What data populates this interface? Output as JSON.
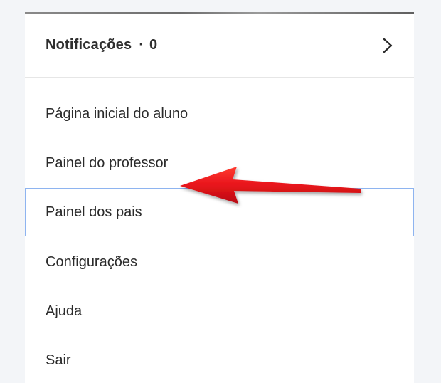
{
  "notifications": {
    "label": "Notificações",
    "separator": "·",
    "count": "0",
    "chevron_icon": "chevron-right-icon"
  },
  "menu": {
    "items": [
      {
        "label": "Página inicial do aluno",
        "active": false
      },
      {
        "label": "Painel do professor",
        "active": false
      },
      {
        "label": "Painel dos pais",
        "active": true
      },
      {
        "label": "Configurações",
        "active": false
      },
      {
        "label": "Ajuda",
        "active": false
      },
      {
        "label": "Sair",
        "active": false
      }
    ]
  },
  "annotation": {
    "arrow_icon": "red-arrow-icon",
    "color": "#e8141b"
  },
  "colors": {
    "highlight_border": "#8eb4f0",
    "text": "#2b2b2b",
    "background": "#f3f5f8"
  }
}
